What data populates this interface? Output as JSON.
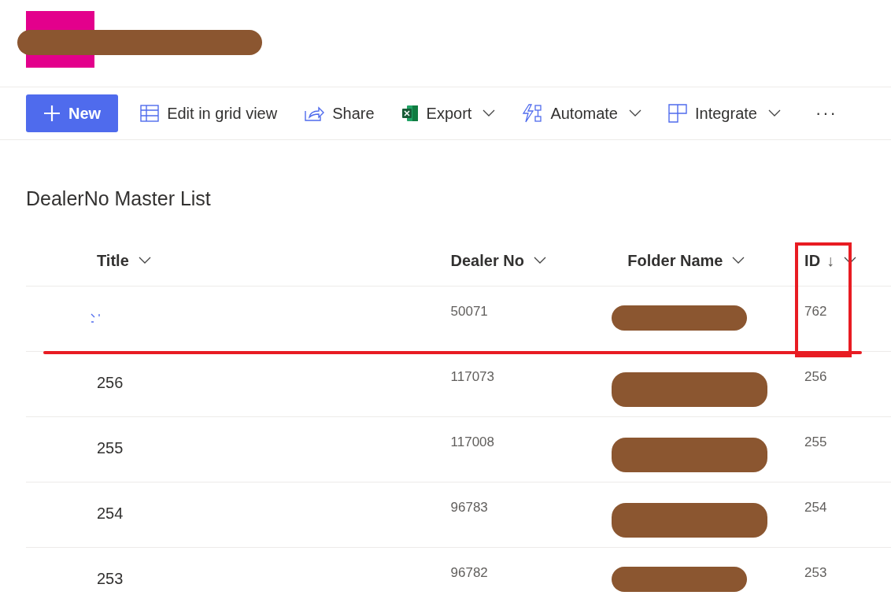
{
  "header": {
    "site_title_redacted": true
  },
  "toolbar": [
    {
      "kind": "primary",
      "label": "New"
    },
    {
      "kind": "plain",
      "label": "Edit in grid view"
    },
    {
      "kind": "plain",
      "label": "Share"
    },
    {
      "kind": "menu",
      "label": "Export"
    },
    {
      "kind": "menu",
      "label": "Automate"
    },
    {
      "kind": "menu",
      "label": "Integrate"
    },
    {
      "kind": "more",
      "label": "···"
    }
  ],
  "list_title": "DealerNo Master List",
  "table": {
    "columns": [
      {
        "label": "Title"
      },
      {
        "label": "Dealer No"
      },
      {
        "label": "Folder Name"
      },
      {
        "label": "ID",
        "sort_glyph": "↓"
      }
    ],
    "rows": [
      {
        "title_loading": true,
        "dealer_no": "50071",
        "folder_redacted": true,
        "id": "762"
      },
      {
        "title": "256",
        "dealer_no": "117073",
        "folder_redacted": true,
        "id": "256"
      },
      {
        "title": "255",
        "dealer_no": "117008",
        "folder_redacted": true,
        "id": "255"
      },
      {
        "title": "254",
        "dealer_no": "96783",
        "folder_redacted": true,
        "id": "254"
      },
      {
        "title": "253",
        "dealer_no": "96782",
        "folder_redacted": true,
        "id": "253"
      }
    ]
  },
  "annotations": {
    "id_column_box": true,
    "first_row_underline": true
  }
}
